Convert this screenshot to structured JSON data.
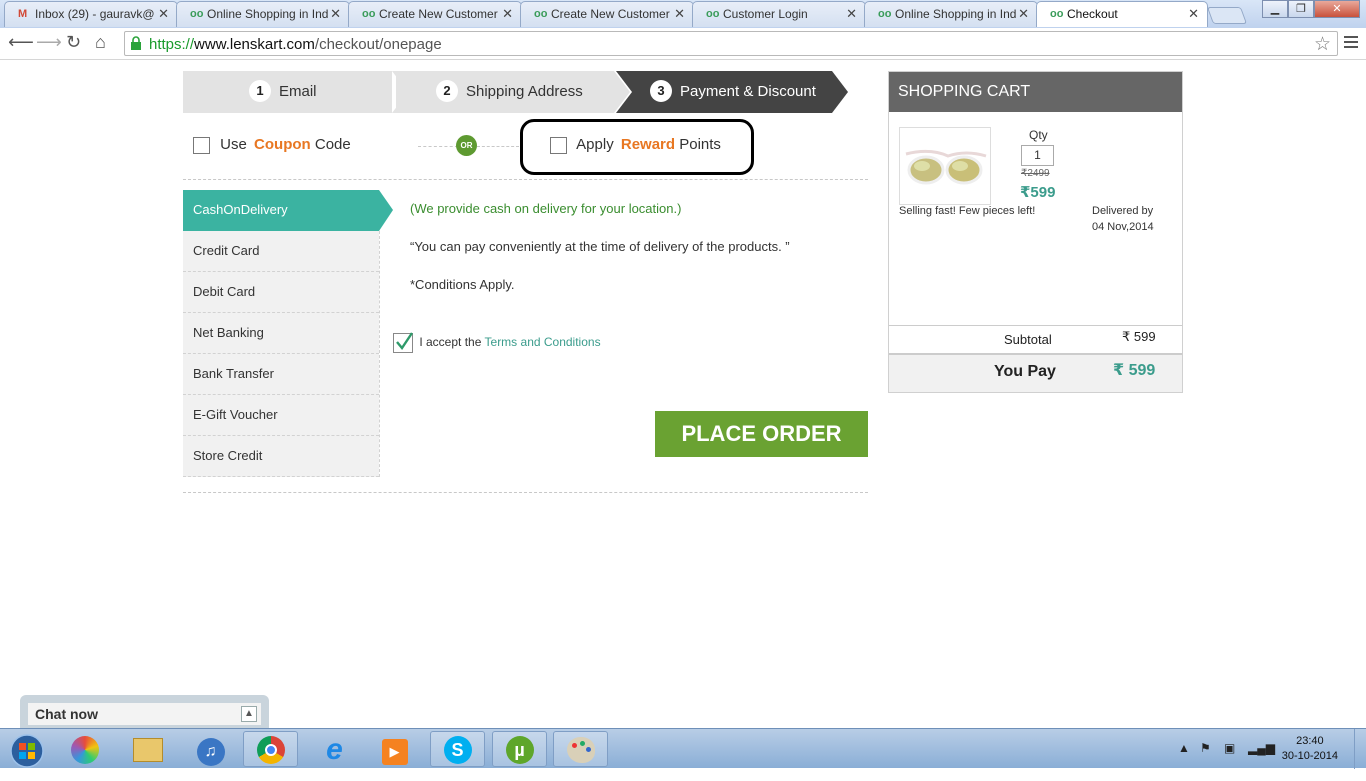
{
  "browser": {
    "tabs": [
      {
        "label": "Inbox (29) - gauravk@",
        "icon": "gmail-icon"
      },
      {
        "label": "Online Shopping in Ind",
        "icon": "lenskart-icon"
      },
      {
        "label": "Create New Customer",
        "icon": "lenskart-icon"
      },
      {
        "label": "Create New Customer",
        "icon": "lenskart-icon"
      },
      {
        "label": "Customer Login",
        "icon": "lenskart-icon"
      },
      {
        "label": "Online Shopping in Ind",
        "icon": "lenskart-icon"
      },
      {
        "label": "Checkout",
        "icon": "lenskart-icon"
      }
    ],
    "url_scheme": "https://",
    "url_host": "www.lenskart.com",
    "url_path": "/checkout/onepage"
  },
  "steps": [
    {
      "num": "1",
      "label": "Email"
    },
    {
      "num": "2",
      "label": "Shipping Address"
    },
    {
      "num": "3",
      "label": "Payment & Discount"
    }
  ],
  "coupon": {
    "prefix": "Use",
    "highlight": "Coupon",
    "suffix": "Code"
  },
  "or_label": "OR",
  "reward": {
    "prefix": "Apply",
    "highlight": "Reward",
    "suffix": "Points"
  },
  "payment_methods": [
    "CashOnDelivery",
    "Credit Card",
    "Debit Card",
    "Net Banking",
    "Bank Transfer",
    "E-Gift Voucher",
    "Store Credit"
  ],
  "cod": {
    "note": "(We provide cash on delivery for your location.)",
    "quote": "“You can pay conveniently at the time of delivery of the products. ”",
    "conditions": "*Conditions Apply."
  },
  "terms": {
    "prefix": "I accept the",
    "link": "Terms and Conditions"
  },
  "place_order_label": "PLACE ORDER",
  "cart": {
    "title": "SHOPPING CART",
    "qty_label": "Qty",
    "qty_value": "1",
    "old_price": "₹2499",
    "price": "₹599",
    "stock_note": "Selling fast! Few pieces left!",
    "delivered_label": "Delivered by",
    "delivered_date": "04 Nov,2014",
    "subtotal_label": "Subtotal",
    "subtotal_value": "₹ 599",
    "youpay_label": "You Pay",
    "youpay_value": "₹ 599"
  },
  "chat": {
    "label": "Chat now"
  },
  "taskbar": {
    "time": "23:40",
    "date": "30-10-2014"
  },
  "colors": {
    "accent_teal": "#3bb3a1",
    "orange": "#e87722",
    "order_green": "#6aa232"
  }
}
